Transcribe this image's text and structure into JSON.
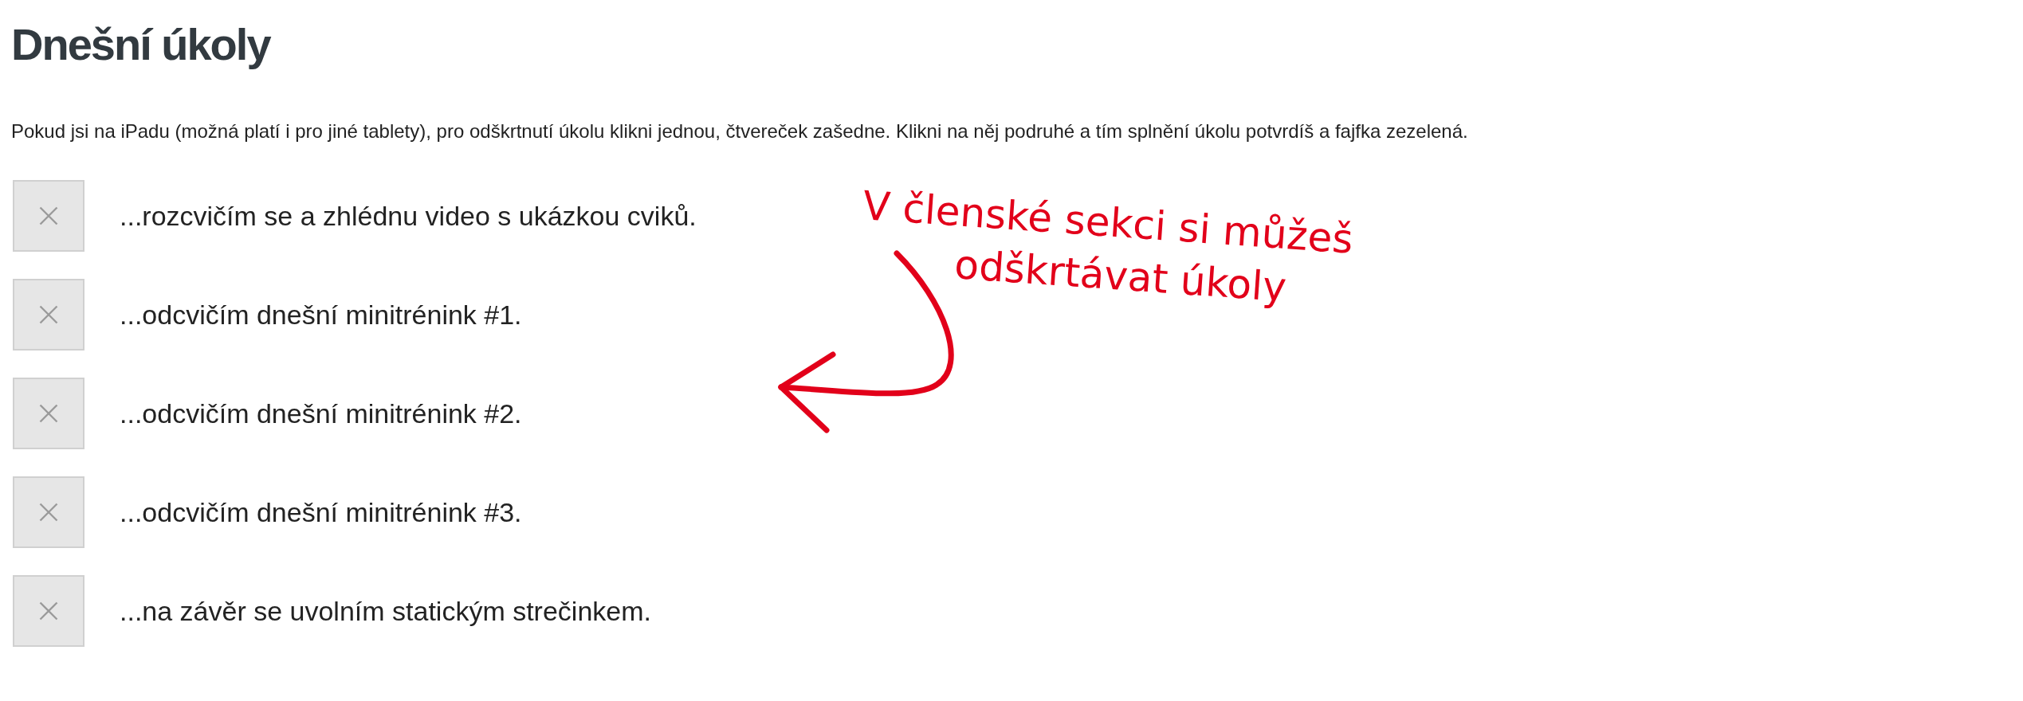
{
  "title": "Dnešní úkoly",
  "intro": "Pokud jsi na iPadu (možná platí i pro jiné tablety), pro odškrtnutí úkolu klikni jednou, čtvereček zašedne. Klikni na něj podruhé a tím splnění úkolu potvrdíš a fajfka zezelená.",
  "tasks": [
    {
      "label": "...rozcvičím se a zhlédnu video s ukázkou cviků.",
      "checked": false
    },
    {
      "label": "...odcvičím dnešní minitrénink #1.",
      "checked": false
    },
    {
      "label": "...odcvičím dnešní minitrénink #2.",
      "checked": false
    },
    {
      "label": "...odcvičím dnešní minitrénink #3.",
      "checked": false
    },
    {
      "label": "...na závěr se uvolním statickým strečinkem.",
      "checked": false
    }
  ],
  "annotation": {
    "lines": [
      "V členské sekci si můžeš",
      "odškrtávat úkoly"
    ]
  }
}
